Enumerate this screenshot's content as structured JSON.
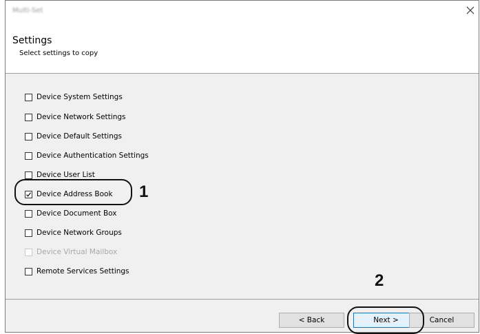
{
  "window": {
    "title": "Multi-Set",
    "close_glyph": "✕"
  },
  "header": {
    "title": "Settings",
    "subtitle": "Select settings to copy"
  },
  "items": [
    {
      "label": "Device System Settings",
      "checked": false,
      "disabled": false
    },
    {
      "label": "Device Network Settings",
      "checked": false,
      "disabled": false
    },
    {
      "label": "Device Default Settings",
      "checked": false,
      "disabled": false
    },
    {
      "label": "Device Authentication Settings",
      "checked": false,
      "disabled": false
    },
    {
      "label": "Device User List",
      "checked": false,
      "disabled": false
    },
    {
      "label": "Device Address Book",
      "checked": true,
      "disabled": false
    },
    {
      "label": "Device Document Box",
      "checked": false,
      "disabled": false
    },
    {
      "label": "Device Network Groups",
      "checked": false,
      "disabled": false
    },
    {
      "label": "Device Virtual Mailbox",
      "checked": false,
      "disabled": true
    },
    {
      "label": "Remote Services Settings",
      "checked": false,
      "disabled": false
    }
  ],
  "annotations": {
    "step1": "1",
    "step2": "2"
  },
  "buttons": {
    "back": "< Back",
    "next": "Next >",
    "cancel": "Cancel"
  },
  "colors": {
    "accent": "#0078d7",
    "disabled_text": "#a8a8a8"
  }
}
